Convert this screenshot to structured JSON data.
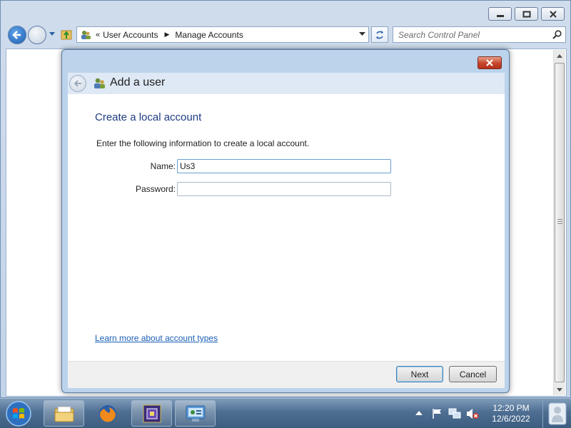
{
  "window": {
    "breadcrumb": [
      "User Accounts",
      "Manage Accounts"
    ],
    "breadcrumb_prefix": "«",
    "search_placeholder": "Search Control Panel",
    "icons": [
      "back-icon",
      "forward-icon",
      "recent-pages-icon",
      "up-folder-icon",
      "user-accounts-icon",
      "dropdown-icon",
      "refresh-icon",
      "search-icon",
      "minimize-icon",
      "maximize-icon",
      "close-icon"
    ]
  },
  "dialog": {
    "title": "Add a user",
    "heading": "Create a local account",
    "instruction": "Enter the following information to create a local account.",
    "name_label": "Name:",
    "name_value": "Us3",
    "password_label": "Password:",
    "password_value": "",
    "learn_more_link": "Learn more about account types",
    "next_label": "Next",
    "cancel_label": "Cancel"
  },
  "taskbar": {
    "apps": [
      "start-orb-icon",
      "windows-explorer-icon",
      "firefox-icon",
      "app-icon",
      "control-panel-icon"
    ],
    "tray_icons": [
      "show-hidden-icons",
      "action-center-flag-icon",
      "network-icon",
      "volume-muted-icon"
    ],
    "time": "12:20 PM",
    "date": "12/6/2022"
  },
  "colors": {
    "heading": "#1e3d82",
    "link": "#1a5fb4",
    "close_button": "#c5462b",
    "taskbar": "#4e6e92"
  }
}
